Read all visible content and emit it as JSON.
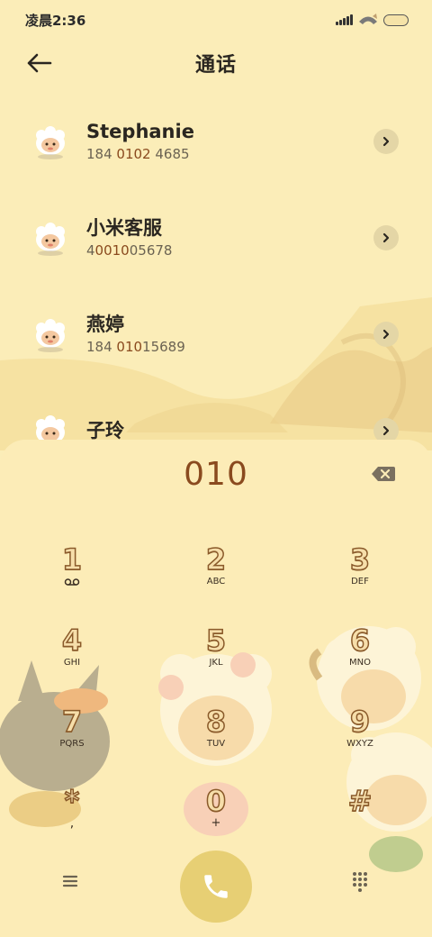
{
  "status_bar": {
    "time": "凌晨2:36",
    "signal_icon": "signal-bars-icon",
    "wifi_icon": "wifi-icon",
    "battery_icon": "battery-icon"
  },
  "header": {
    "title": "通话",
    "back_icon": "back-arrow-icon"
  },
  "contacts": [
    {
      "name": "Stephanie",
      "number_pre": "184 ",
      "number_match": "0102",
      "number_post": " 4685"
    },
    {
      "name": "小米客服",
      "number_pre": "4",
      "number_match": "0010",
      "number_post": "05678"
    },
    {
      "name": "燕婷",
      "number_pre": "184 ",
      "number_match": "010",
      "number_post": "15689"
    },
    {
      "name": "子玲",
      "number_pre": "",
      "number_match": "",
      "number_post": ""
    }
  ],
  "dialer": {
    "input": "010",
    "backspace_icon": "backspace-icon",
    "keys": [
      {
        "digit": "1",
        "sub": "voicemail"
      },
      {
        "digit": "2",
        "sub": "ABC"
      },
      {
        "digit": "3",
        "sub": "DEF"
      },
      {
        "digit": "4",
        "sub": "GHI"
      },
      {
        "digit": "5",
        "sub": "JKL"
      },
      {
        "digit": "6",
        "sub": "MNO"
      },
      {
        "digit": "7",
        "sub": "PQRS"
      },
      {
        "digit": "8",
        "sub": "TUV"
      },
      {
        "digit": "9",
        "sub": "WXYZ"
      },
      {
        "digit": "*",
        "sub": ","
      },
      {
        "digit": "0",
        "sub": "+"
      },
      {
        "digit": "#",
        "sub": ""
      }
    ]
  },
  "bottom": {
    "menu_icon": "menu-icon",
    "call_icon": "phone-icon",
    "keypad_icon": "keypad-icon"
  },
  "colors": {
    "background": "#fbedb8",
    "accent": "#8a4a1e",
    "call_button": "#e7cf74"
  }
}
